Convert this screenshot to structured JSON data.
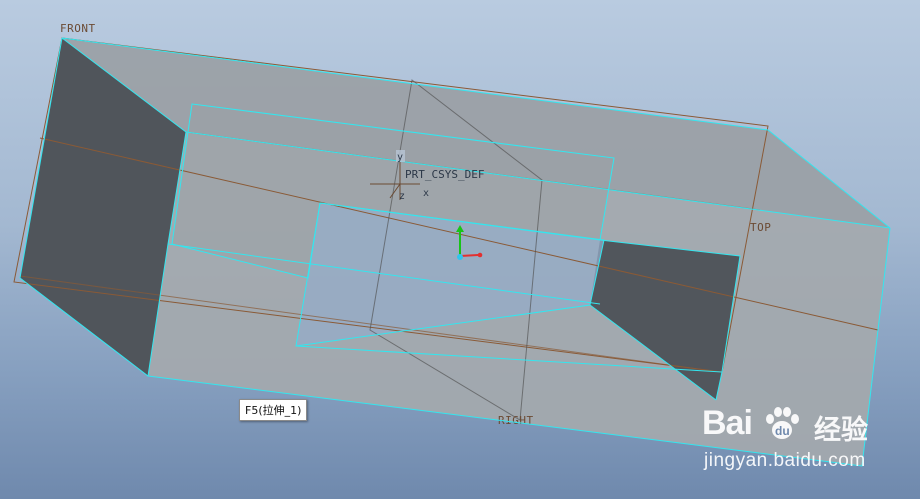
{
  "datum_planes": {
    "front_label": "FRONT",
    "top_label": "TOP",
    "right_label": "RIGHT"
  },
  "csys": {
    "label": "PRT_CSYS_DEF",
    "axis_y": "y",
    "axis_x": "x",
    "axis_z": "z"
  },
  "tooltip": {
    "text": "F5(拉伸_1)"
  },
  "watermark": {
    "brand_latin": "Bai",
    "brand_du": "du",
    "brand_cn": "经验",
    "url": "jingyan.baidu.com"
  },
  "colors": {
    "background_top": "#b9cbe0",
    "background_bottom": "#6f89ad",
    "model_edge_highlight": "#33e6ef",
    "datum_plane": "#8a5a36",
    "solid_face_light": "#a4a9ad",
    "solid_face_dark": "#51565c"
  },
  "icons": [
    "csys-triad-icon",
    "baidu-paw-icon"
  ]
}
